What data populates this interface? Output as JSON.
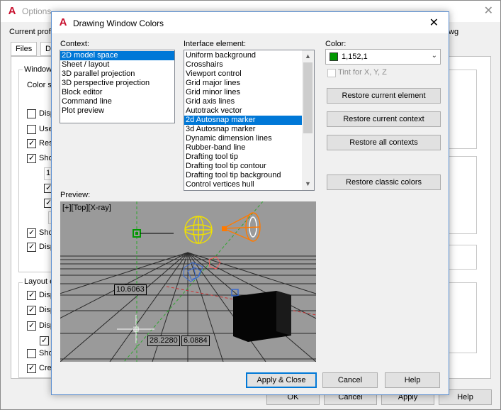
{
  "background_window": {
    "title": "Options",
    "profile_label": "Current profil",
    "dwg_label": "wg",
    "tabs": [
      "Files",
      "Di"
    ],
    "window_group_label": "Window",
    "color_scheme_label": "Color sc",
    "window_checks": [
      {
        "text": "Disp",
        "checked": false
      },
      {
        "text": "Use",
        "checked": false
      },
      {
        "text": "Res",
        "checked": true
      },
      {
        "text": "Sho",
        "checked": true
      },
      {
        "text": "",
        "checked": true
      },
      {
        "text": "",
        "checked": true
      },
      {
        "text": "Sho",
        "checked": true
      },
      {
        "text": "Disp",
        "checked": true
      }
    ],
    "field_partial": "1.",
    "layout_group_label": "Layout e",
    "layout_checks": [
      {
        "text": "Disp",
        "checked": true
      },
      {
        "text": "Disp",
        "checked": true
      },
      {
        "text": "Disp",
        "checked": true
      },
      {
        "text": "",
        "checked": true
      },
      {
        "text": "Sho",
        "checked": false
      },
      {
        "text": "Crea",
        "checked": true
      }
    ],
    "buttons": [
      "OK",
      "Cancel",
      "Apply",
      "Help"
    ]
  },
  "dialog": {
    "title": "Drawing Window Colors",
    "close_glyph": "✕",
    "context": {
      "label": "Context:",
      "items": [
        "2D model space",
        "Sheet / layout",
        "3D parallel projection",
        "3D perspective projection",
        "Block editor",
        "Command line",
        "Plot preview"
      ],
      "selected_index": 0
    },
    "interface_element": {
      "label": "Interface element:",
      "items": [
        "Uniform background",
        "Crosshairs",
        "Viewport control",
        "Grid major lines",
        "Grid minor lines",
        "Grid axis lines",
        "Autotrack vector",
        "2d Autosnap marker",
        "3d Autosnap marker",
        "Dynamic dimension lines",
        "Rubber-band line",
        "Drafting tool tip",
        "Drafting tool tip contour",
        "Drafting tool tip background",
        "Control vertices hull"
      ],
      "selected_index": 7
    },
    "color": {
      "label": "Color:",
      "value": "1,152,1",
      "swatch_color": "#019801",
      "tint_label": "Tint for X, Y, Z",
      "tint_checked": false,
      "tint_enabled": false
    },
    "buttons": {
      "restore_element": "Restore current element",
      "restore_context": "Restore current context",
      "restore_all": "Restore all contexts",
      "restore_classic": "Restore classic colors",
      "apply_close": "Apply & Close",
      "cancel": "Cancel",
      "help": "Help"
    },
    "preview": {
      "label": "Preview:",
      "viewport_caption": "[+][Top][X-ray]",
      "dim_values": [
        "10.6063",
        "28.2280",
        "6.0884"
      ],
      "background_color": "#9a9a9a",
      "autosnap_marker_color": "#019801"
    }
  },
  "colors": {
    "accent": "#0078d7",
    "app_icon_red": "#c8102e"
  }
}
